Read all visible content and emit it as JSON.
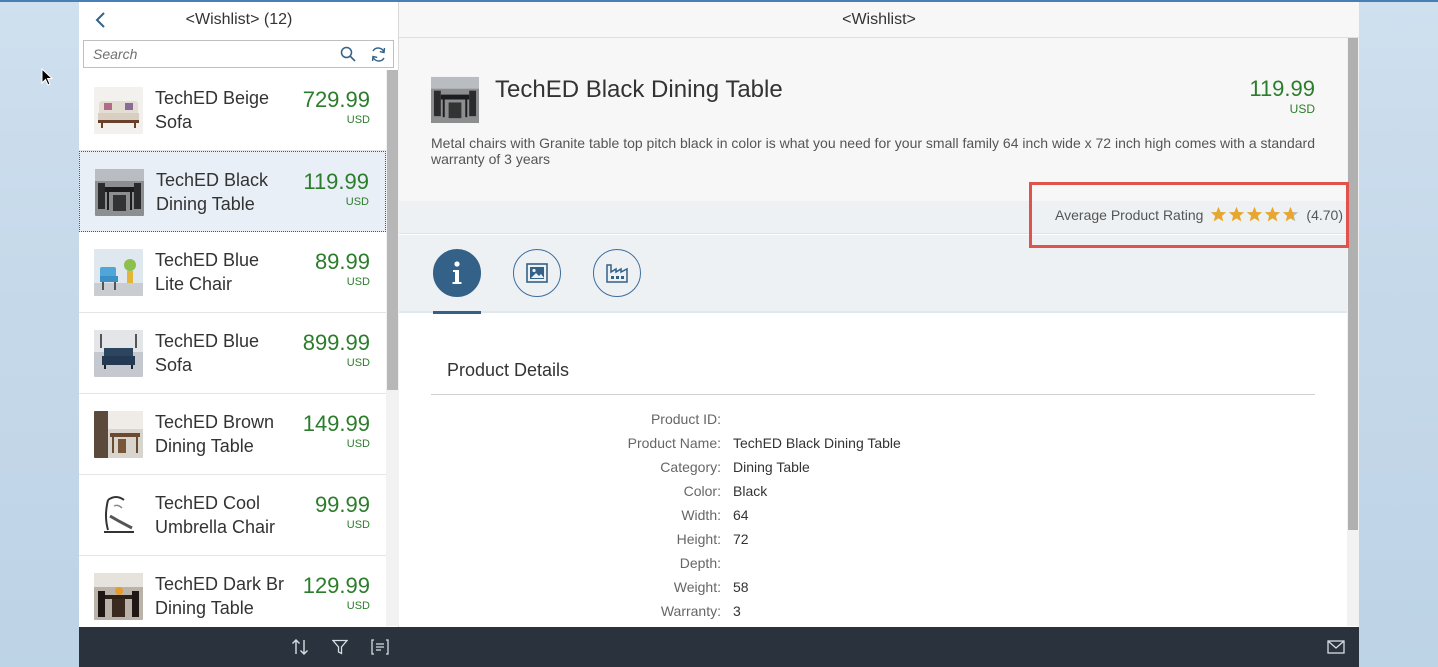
{
  "master": {
    "title": "<Wishlist> (12)",
    "search_placeholder": "Search",
    "items": [
      {
        "title": "TechED Beige Sofa",
        "price": "729.99",
        "currency": "USD",
        "selected": false
      },
      {
        "title": "TechED Black Dining Table",
        "price": "119.99",
        "currency": "USD",
        "selected": true
      },
      {
        "title": "TechED Blue Lite Chair",
        "price": "89.99",
        "currency": "USD",
        "selected": false
      },
      {
        "title": "TechED Blue Sofa",
        "price": "899.99",
        "currency": "USD",
        "selected": false
      },
      {
        "title": "TechED Brown Dining Table",
        "price": "149.99",
        "currency": "USD",
        "selected": false
      },
      {
        "title": "TechED Cool Umbrella Chair",
        "price": "99.99",
        "currency": "USD",
        "selected": false
      },
      {
        "title": "TechED Dark Br Dining Table",
        "price": "129.99",
        "currency": "USD",
        "selected": false
      }
    ]
  },
  "detail": {
    "title": "<Wishlist>",
    "product_title": "TechED Black Dining Table",
    "price": "119.99",
    "currency": "USD",
    "description": "Metal chairs with Granite table top pitch black in color is what you need for your small family 64 inch wide x 72 inch high comes with a standard warranty of 3 years",
    "rating_label": "Average Product Rating",
    "rating_value": 4.7,
    "rating_text": "(4.70)",
    "tabs": [
      {
        "icon": "info-icon",
        "active": true
      },
      {
        "icon": "image-icon",
        "active": false
      },
      {
        "icon": "factory-icon",
        "active": false
      }
    ],
    "section_title": "Product Details",
    "fields": [
      {
        "label": "Product ID:",
        "value": ""
      },
      {
        "label": "Product Name:",
        "value": "TechED Black Dining Table"
      },
      {
        "label": "Category:",
        "value": "Dining Table"
      },
      {
        "label": "Color:",
        "value": "Black"
      },
      {
        "label": "Width:",
        "value": "64"
      },
      {
        "label": "Height:",
        "value": "72"
      },
      {
        "label": "Depth:",
        "value": ""
      },
      {
        "label": "Weight:",
        "value": "58"
      },
      {
        "label": "Warranty:",
        "value": "3"
      }
    ]
  },
  "colors": {
    "price_green": "#2b7d2b",
    "footer_dark": "#29323d",
    "accent_blue": "#346187",
    "star_gold": "#e7a72f",
    "highlight_red": "#e0534c"
  }
}
